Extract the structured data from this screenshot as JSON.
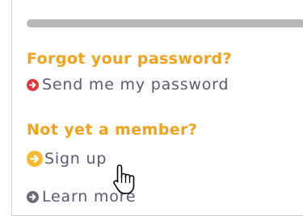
{
  "sections": [
    {
      "heading": "Forgot your password?",
      "link": {
        "label": "Send me my password",
        "icon": "arrow-right-circle-icon",
        "icon_color": "#e2343a"
      }
    },
    {
      "heading": "Not yet a member?",
      "link": {
        "label": "Sign up",
        "icon": "arrow-right-circle-icon",
        "icon_color": "#f9b92d"
      }
    }
  ],
  "extra_link": {
    "label": "Learn more",
    "icon": "arrow-right-circle-icon",
    "icon_color": "#6a6a7e"
  },
  "colors": {
    "heading": "#f5a21a",
    "link_text": "#5a5a72",
    "bar": "#b8b8b8"
  }
}
